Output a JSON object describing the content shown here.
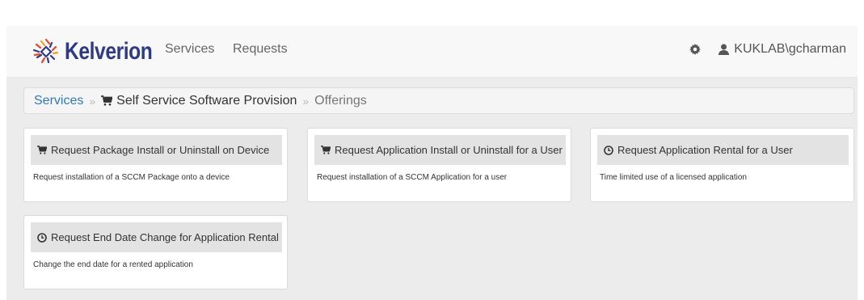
{
  "brand": {
    "name": "Kelverion"
  },
  "nav": {
    "services": "Services",
    "requests": "Requests"
  },
  "user": {
    "name": "KUKLAB\\gcharman"
  },
  "icons": {
    "settings": "gear-icon",
    "user": "user-icon",
    "cart": "cart-icon",
    "clock": "clock-icon"
  },
  "breadcrumb": {
    "services": "Services",
    "separator": "»",
    "catalog": "Self Service Software Provision",
    "current": "Offerings"
  },
  "offerings": [
    {
      "icon": "cart-icon",
      "title": "Request Package Install or Uninstall on Device",
      "description": "Request installation of a SCCM Package onto a device"
    },
    {
      "icon": "cart-icon",
      "title": "Request Application Install or Uninstall for a User",
      "description": "Request installation of a SCCM Application for a user"
    },
    {
      "icon": "clock-icon",
      "title": "Request Application Rental for a User",
      "description": "Time limited use of a licensed application"
    },
    {
      "icon": "clock-icon",
      "title": "Request End Date Change for Application Rental",
      "description": "Change the end date for a rented application"
    }
  ],
  "colors": {
    "brand": "#2e3b84",
    "link": "#337ab7",
    "accent": "#e8462c"
  }
}
